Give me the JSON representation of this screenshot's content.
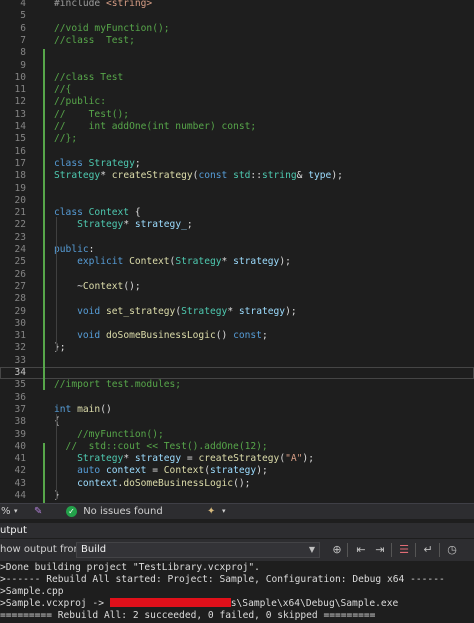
{
  "editor": {
    "lines": [
      {
        "num": "4",
        "segs": [
          [
            "#include ",
            "c-pp"
          ],
          [
            "<string>",
            "c-str"
          ]
        ]
      },
      {
        "num": "5",
        "segs": []
      },
      {
        "num": "6",
        "segs": [
          [
            "//void myFunction();",
            "c-com"
          ]
        ]
      },
      {
        "num": "7",
        "segs": [
          [
            "//class  Test;",
            "c-com"
          ]
        ]
      },
      {
        "num": "8",
        "segs": []
      },
      {
        "num": "9",
        "segs": []
      },
      {
        "num": "10",
        "segs": [
          [
            "//class Test",
            "c-com"
          ]
        ]
      },
      {
        "num": "11",
        "segs": [
          [
            "//{",
            "c-com"
          ]
        ]
      },
      {
        "num": "12",
        "segs": [
          [
            "//public:",
            "c-com"
          ]
        ]
      },
      {
        "num": "13",
        "segs": [
          [
            "//    Test();",
            "c-com"
          ]
        ]
      },
      {
        "num": "14",
        "segs": [
          [
            "//    int addOne(int number) const;",
            "c-com"
          ]
        ]
      },
      {
        "num": "15",
        "segs": [
          [
            "//};",
            "c-com"
          ]
        ]
      },
      {
        "num": "16",
        "segs": []
      },
      {
        "num": "17",
        "segs": [
          [
            "class ",
            "c-kw"
          ],
          [
            "Strategy",
            "c-type"
          ],
          [
            ";",
            ""
          ]
        ]
      },
      {
        "num": "18",
        "segs": [
          [
            "Strategy",
            "c-type"
          ],
          [
            "* ",
            ""
          ],
          [
            "createStrategy",
            "c-fn"
          ],
          [
            "(",
            ""
          ],
          [
            "const ",
            "c-kw"
          ],
          [
            "std",
            "c-type"
          ],
          [
            "::",
            ""
          ],
          [
            "string",
            "c-type"
          ],
          [
            "& ",
            ""
          ],
          [
            "type",
            "c-var"
          ],
          [
            ");",
            ""
          ]
        ]
      },
      {
        "num": "19",
        "segs": []
      },
      {
        "num": "20",
        "segs": []
      },
      {
        "num": "21",
        "segs": [
          [
            "class ",
            "c-kw"
          ],
          [
            "Context",
            "c-type"
          ],
          [
            " {",
            ""
          ]
        ]
      },
      {
        "num": "22",
        "segs": [
          [
            "    ",
            ""
          ],
          [
            "Strategy",
            "c-type"
          ],
          [
            "* ",
            ""
          ],
          [
            "strategy_",
            "c-var"
          ],
          [
            ";",
            ""
          ]
        ]
      },
      {
        "num": "23",
        "segs": []
      },
      {
        "num": "24",
        "segs": [
          [
            "public",
            "c-kw"
          ],
          [
            ":",
            ""
          ]
        ]
      },
      {
        "num": "25",
        "segs": [
          [
            "    ",
            ""
          ],
          [
            "explicit ",
            "c-kw"
          ],
          [
            "Context",
            "c-fn"
          ],
          [
            "(",
            ""
          ],
          [
            "Strategy",
            "c-type"
          ],
          [
            "* ",
            ""
          ],
          [
            "strategy",
            "c-var"
          ],
          [
            ");",
            ""
          ]
        ]
      },
      {
        "num": "26",
        "segs": []
      },
      {
        "num": "27",
        "segs": [
          [
            "    ~",
            ""
          ],
          [
            "Context",
            "c-fn"
          ],
          [
            "();",
            ""
          ]
        ]
      },
      {
        "num": "28",
        "segs": []
      },
      {
        "num": "29",
        "segs": [
          [
            "    ",
            ""
          ],
          [
            "void ",
            "c-kw"
          ],
          [
            "set_strategy",
            "c-fn"
          ],
          [
            "(",
            ""
          ],
          [
            "Strategy",
            "c-type"
          ],
          [
            "* ",
            ""
          ],
          [
            "strategy",
            "c-var"
          ],
          [
            ");",
            ""
          ]
        ]
      },
      {
        "num": "30",
        "segs": []
      },
      {
        "num": "31",
        "segs": [
          [
            "    ",
            ""
          ],
          [
            "void ",
            "c-kw"
          ],
          [
            "doSomeBusinessLogic",
            "c-fn"
          ],
          [
            "() ",
            ""
          ],
          [
            "const",
            "c-kw"
          ],
          [
            ";",
            ""
          ]
        ]
      },
      {
        "num": "32",
        "segs": [
          [
            "};",
            ""
          ]
        ]
      },
      {
        "num": "33",
        "segs": []
      },
      {
        "num": "34",
        "segs": [],
        "current": true
      },
      {
        "num": "35",
        "segs": [
          [
            "//import test.modules;",
            "c-com"
          ]
        ]
      },
      {
        "num": "36",
        "segs": []
      },
      {
        "num": "37",
        "segs": [
          [
            "int ",
            "c-kw"
          ],
          [
            "main",
            "c-fn"
          ],
          [
            "()",
            ""
          ]
        ]
      },
      {
        "num": "38",
        "segs": [
          [
            "{",
            ""
          ]
        ]
      },
      {
        "num": "39",
        "segs": [
          [
            "    //myFunction();",
            "c-com"
          ]
        ]
      },
      {
        "num": "40",
        "segs": [
          [
            "  //  std::cout << Test().addOne(12);",
            "c-com"
          ]
        ]
      },
      {
        "num": "41",
        "segs": [
          [
            "    ",
            ""
          ],
          [
            "Strategy",
            "c-type"
          ],
          [
            "* ",
            ""
          ],
          [
            "strategy",
            "c-var"
          ],
          [
            " = ",
            ""
          ],
          [
            "createStrategy",
            "c-fn"
          ],
          [
            "(",
            ""
          ],
          [
            "\"A\"",
            "c-str"
          ],
          [
            ");",
            ""
          ]
        ]
      },
      {
        "num": "42",
        "segs": [
          [
            "    ",
            ""
          ],
          [
            "auto ",
            "c-kw"
          ],
          [
            "context",
            "c-var"
          ],
          [
            " = ",
            ""
          ],
          [
            "Context",
            "c-fn"
          ],
          [
            "(",
            ""
          ],
          [
            "strategy",
            "c-var"
          ],
          [
            ");",
            ""
          ]
        ]
      },
      {
        "num": "43",
        "segs": [
          [
            "    ",
            ""
          ],
          [
            "context",
            "c-var"
          ],
          [
            ".",
            ""
          ],
          [
            "doSomeBusinessLogic",
            "c-fn"
          ],
          [
            "();",
            ""
          ]
        ]
      },
      {
        "num": "44",
        "segs": [
          [
            "}",
            ""
          ]
        ]
      }
    ]
  },
  "statusbar": {
    "zoom": "%",
    "issues": "No issues found"
  },
  "output": {
    "title": "utput",
    "show_from_label": "how output from:",
    "source": "Build",
    "lines": [
      ">Done building project \"TestLibrary.vcxproj\".",
      ">------ Rebuild All started: Project: Sample, Configuration: Debug x64 ------",
      ">Sample.cpp",
      ">Sample.vcxproj -> ",
      "========= Rebuild All: 2 succeeded, 0 failed, 0 skipped ========="
    ],
    "path_suffix": "s\\Sample\\x64\\Debug\\Sample.exe"
  },
  "colors": {
    "editor_bg": "#1e1e1e",
    "comment": "#57a64a",
    "keyword": "#569cd6",
    "type": "#4ec9b0",
    "function": "#dcdcaa",
    "redaction": "#e0101a"
  }
}
